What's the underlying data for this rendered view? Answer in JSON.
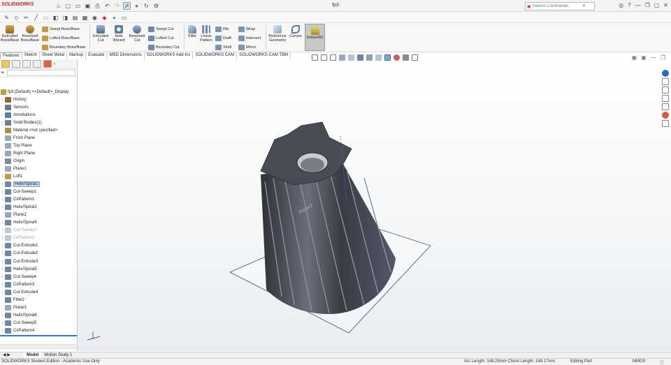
{
  "app": {
    "brand": "SOLIDWORKS",
    "document_title": "fp3"
  },
  "search": {
    "placeholder": "Search Commands"
  },
  "ribbon": {
    "extruded_boss": "Extruded Boss/Base",
    "revolved_boss": "Revolved Boss/Base",
    "swept_boss": "Swept Boss/Base",
    "lofted_boss": "Lofted Boss/Base",
    "boundary_boss": "Boundary Boss/Base",
    "extruded_cut": "Extruded Cut",
    "hole_wizard": "Hole Wizard",
    "revolved_cut": "Revolved Cut",
    "swept_cut": "Swept Cut",
    "lofted_cut": "Lofted Cut",
    "boundary_cut": "Boundary Cut",
    "fillet": "Fillet",
    "linear_pattern": "Linear Pattern",
    "rib": "Rib",
    "draft": "Draft",
    "shell": "Shell",
    "wrap": "Wrap",
    "intersect": "Intersect",
    "mirror": "Mirror",
    "reference_geometry": "Reference Geometry",
    "curves": "Curves",
    "instant3d": "Instant3D"
  },
  "tabs": [
    "Features",
    "Sketch",
    "Sheet Metal",
    "Markup",
    "Evaluate",
    "MBD Dimensions",
    "SOLIDWORKS Add-Ins",
    "SOLIDWORKS CAM",
    "SOLIDWORKS CAM TBM"
  ],
  "tree": {
    "root": "fp3 (Default) <<Default>_Display",
    "items": [
      {
        "label": "History",
        "state": "normal",
        "arrow": "›",
        "icon": "#8a6f3a"
      },
      {
        "label": "Sensors",
        "state": "normal",
        "arrow": "",
        "icon": "#6a7a8a"
      },
      {
        "label": "Annotations",
        "state": "normal",
        "arrow": "›",
        "icon": "#5b7fa8"
      },
      {
        "label": "Solid Bodies(1)",
        "state": "normal",
        "arrow": "›",
        "icon": "#6b7f95"
      },
      {
        "label": "Material <not specified>",
        "state": "normal",
        "arrow": "",
        "icon": "#b28a4c"
      },
      {
        "label": "Front Plane",
        "state": "normal",
        "arrow": "",
        "icon": "#9aa9b8"
      },
      {
        "label": "Top Plane",
        "state": "normal",
        "arrow": "",
        "icon": "#9aa9b8"
      },
      {
        "label": "Right Plane",
        "state": "normal",
        "arrow": "",
        "icon": "#9aa9b8"
      },
      {
        "label": "Origin",
        "state": "normal",
        "arrow": "",
        "icon": "#7e8c9a"
      },
      {
        "label": "Plane1",
        "state": "normal",
        "arrow": "",
        "icon": "#9aa9b8"
      },
      {
        "label": "Loft1",
        "state": "normal",
        "arrow": "›",
        "icon": "#c79a3a"
      },
      {
        "label": "Helix/Spiral1",
        "state": "selected",
        "arrow": "›",
        "icon": "#6d88a6"
      },
      {
        "label": "Cut-Sweep1",
        "state": "normal",
        "arrow": "›",
        "icon": "#6d88a6"
      },
      {
        "label": "CirPattern1",
        "state": "normal",
        "arrow": "›",
        "icon": "#6d88a6"
      },
      {
        "label": "Helix/Spiral2",
        "state": "normal",
        "arrow": "›",
        "icon": "#6d88a6"
      },
      {
        "label": "Plane2",
        "state": "normal",
        "arrow": "",
        "icon": "#9aa9b8"
      },
      {
        "label": "Helix/Spiral4",
        "state": "normal",
        "arrow": "›",
        "icon": "#6d88a6"
      },
      {
        "label": "Cut-Sweep3",
        "state": "dim",
        "arrow": "›",
        "icon": "#bfc7cf"
      },
      {
        "label": "CirPattern2",
        "state": "dim",
        "arrow": "›",
        "icon": "#bfc7cf"
      },
      {
        "label": "Cut-Extrude1",
        "state": "normal",
        "arrow": "›",
        "icon": "#6d88a6"
      },
      {
        "label": "Cut-Extrude2",
        "state": "normal",
        "arrow": "›",
        "icon": "#6d88a6"
      },
      {
        "label": "Cut-Extrude3",
        "state": "normal",
        "arrow": "›",
        "icon": "#6d88a6"
      },
      {
        "label": "Helix/Spiral5",
        "state": "normal",
        "arrow": "›",
        "icon": "#6d88a6"
      },
      {
        "label": "Cut-Sweep4",
        "state": "normal",
        "arrow": "›",
        "icon": "#6d88a6"
      },
      {
        "label": "CirPattern3",
        "state": "normal",
        "arrow": "›",
        "icon": "#6d88a6"
      },
      {
        "label": "Cut-Extrude4",
        "state": "normal",
        "arrow": "›",
        "icon": "#6d88a6"
      },
      {
        "label": "Fillet2",
        "state": "normal",
        "arrow": "",
        "icon": "#6d88a6"
      },
      {
        "label": "Plane3",
        "state": "normal",
        "arrow": "",
        "icon": "#9aa9b8"
      },
      {
        "label": "Helix/Spiral6",
        "state": "normal",
        "arrow": "›",
        "icon": "#6d88a6"
      },
      {
        "label": "Cut-Sweep5",
        "state": "normal",
        "arrow": "›",
        "icon": "#6d88a6"
      },
      {
        "label": "CirPattern4",
        "state": "normal",
        "arrow": "›",
        "icon": "#6d88a6"
      }
    ]
  },
  "viewport": {
    "plane_label": "Plane3"
  },
  "bottom_tabs": [
    "Model",
    "Motion Study 1"
  ],
  "status": {
    "edition": "SOLIDWORKS Student Edition - Academic Use Only",
    "measure": "Arc Length: 148.25mm Chord Length: 148.17mm",
    "mode": "Editing Part",
    "units": "MMGS"
  },
  "colors": {
    "accent": "#2a7cc7",
    "brand": "#d0262b",
    "model_dark": "#3f4048",
    "model_light": "#8a8d99"
  }
}
